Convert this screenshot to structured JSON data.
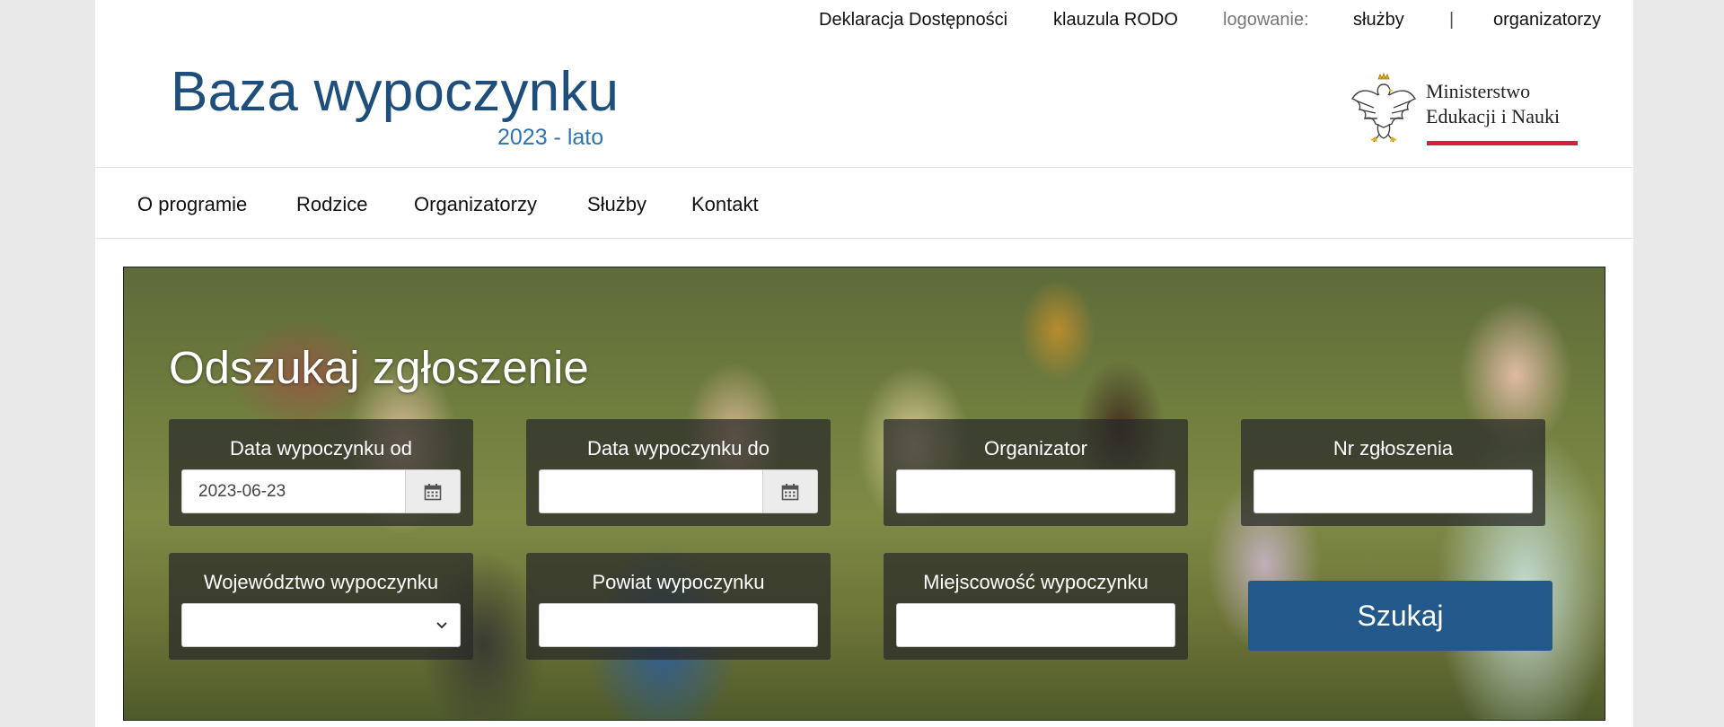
{
  "topbar": {
    "accessibility": "Deklaracja Dostępności",
    "rodo": "klauzula RODO",
    "login_label": "logowanie:",
    "login_services": "służby",
    "separator": "|",
    "login_organizers": "organizatorzy"
  },
  "logo": {
    "title": "Baza wypoczynku",
    "subtitle": "2023 - lato"
  },
  "ministry": {
    "line1": "Ministerstwo",
    "line2": "Edukacji i Nauki",
    "accent_color": "#d4213d"
  },
  "nav": {
    "items": [
      {
        "label": "O programie"
      },
      {
        "label": "Rodzice"
      },
      {
        "label": "Organizatorzy"
      },
      {
        "label": "Służby"
      },
      {
        "label": "Kontakt"
      }
    ]
  },
  "search": {
    "title": "Odszukaj zgłoszenie",
    "date_from": {
      "label": "Data wypoczynku od",
      "value": "2023-06-23"
    },
    "date_to": {
      "label": "Data wypoczynku do",
      "value": ""
    },
    "organizer": {
      "label": "Organizator",
      "value": ""
    },
    "number": {
      "label": "Nr zgłoszenia",
      "value": ""
    },
    "voivodeship": {
      "label": "Województwo wypoczynku",
      "value": ""
    },
    "county": {
      "label": "Powiat wypoczynku",
      "value": ""
    },
    "locality": {
      "label": "Miejscowość wypoczynku",
      "value": ""
    },
    "button_label": "Szukaj",
    "button_color": "#22598a"
  },
  "colors": {
    "brand_dark": "#1e4f7c",
    "brand_light": "#2f73b3"
  },
  "icons": {
    "calendar": "calendar-icon",
    "chevron": "chevron-down-icon",
    "eagle": "eagle-emblem-icon"
  }
}
